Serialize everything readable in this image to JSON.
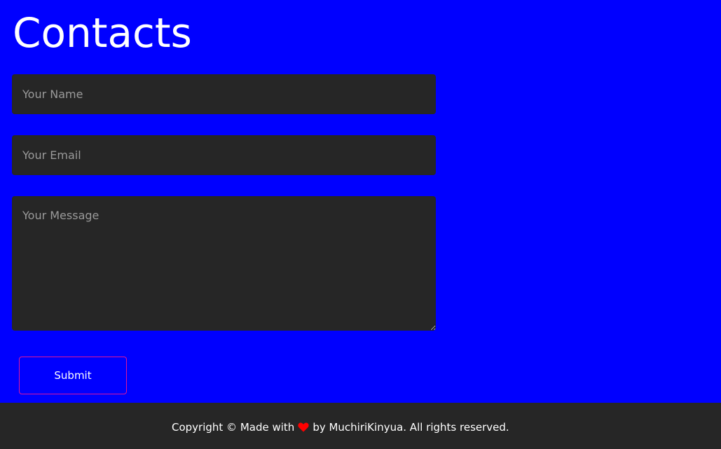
{
  "header": {
    "title": "Contacts"
  },
  "form": {
    "name_placeholder": "Your Name",
    "email_placeholder": "Your Email",
    "message_placeholder": "Your Message",
    "submit_label": "Submit"
  },
  "footer": {
    "text_before": "Copyright © Made with",
    "icon": "heart-icon",
    "text_after": "by MuchiriKinyua. All rights reserved."
  },
  "colors": {
    "background": "#0000ff",
    "field_background": "#262626",
    "submit_border": "#e0159a",
    "heart": "#ff0000"
  }
}
